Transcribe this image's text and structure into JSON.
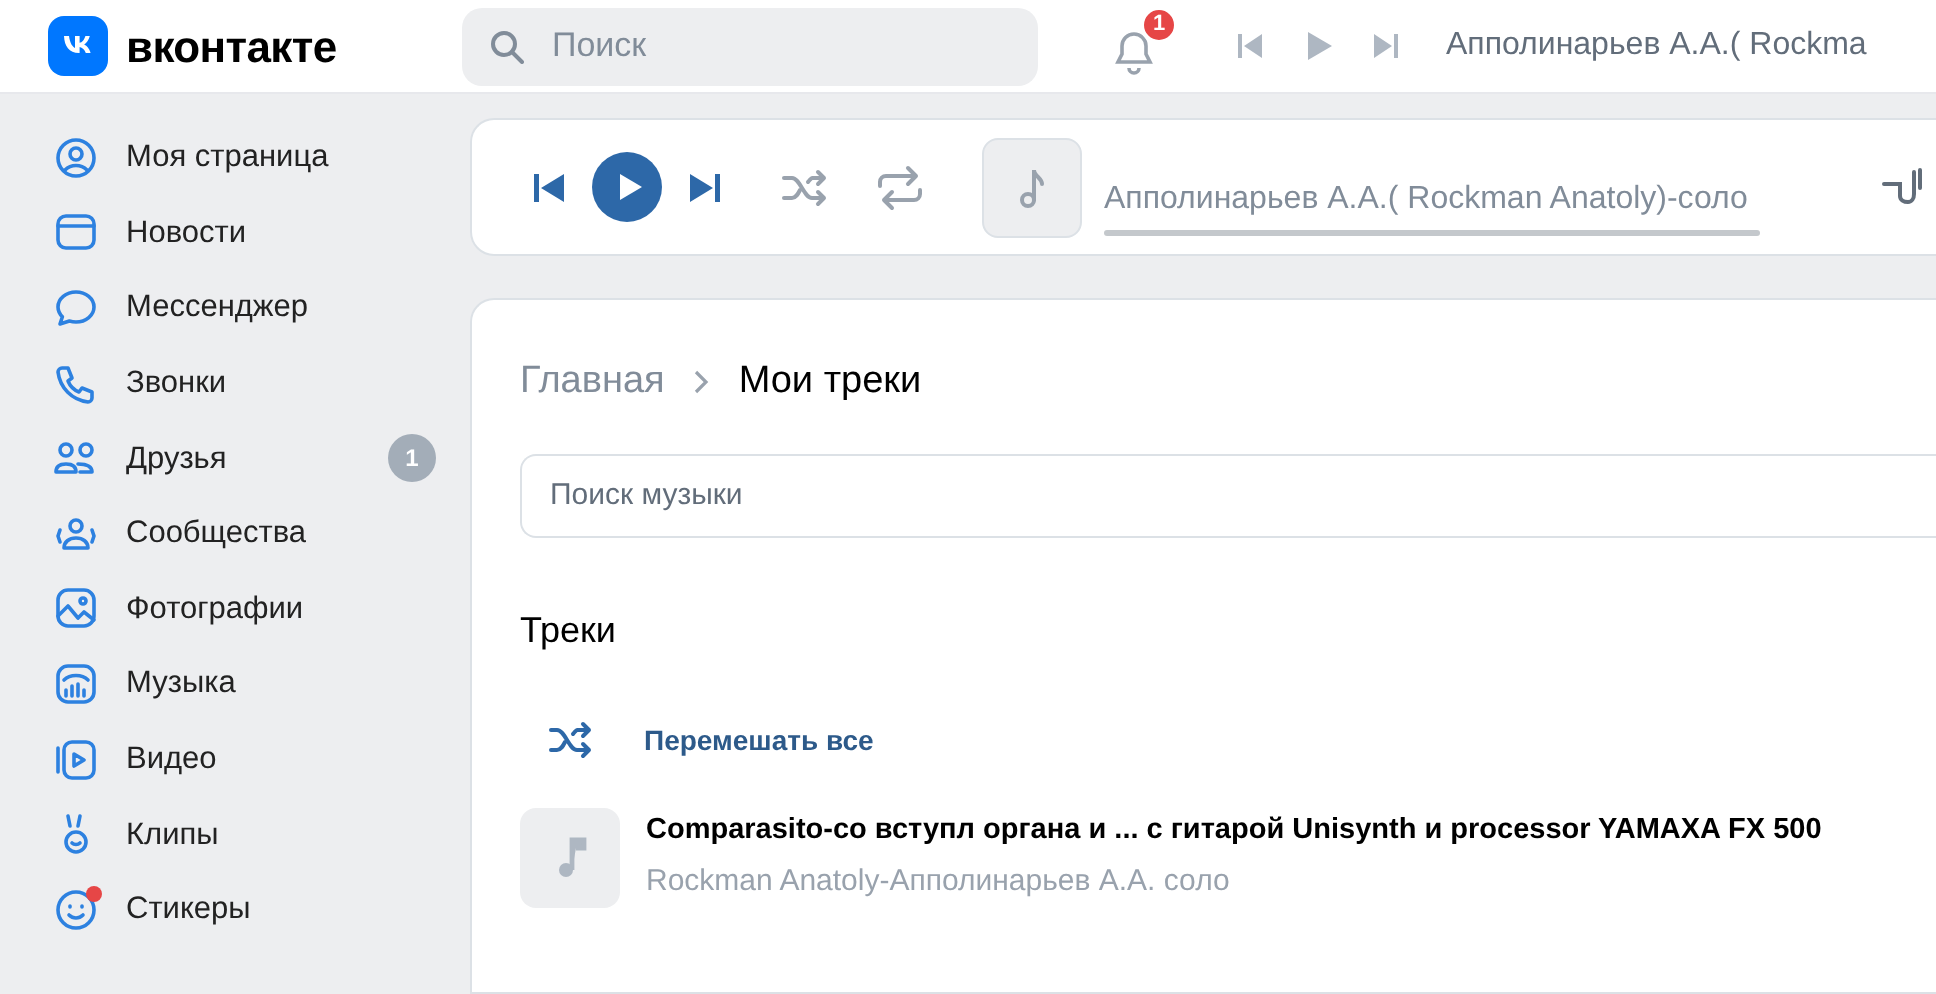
{
  "header": {
    "logo_text": "вконтакте",
    "search": {
      "placeholder": "Поиск"
    },
    "notifications_badge": "1",
    "now_playing": "Апполинарьев А.А.( Rockma"
  },
  "sidebar": {
    "items": [
      {
        "label": "Моя страница",
        "dot": false
      },
      {
        "label": "Новости",
        "dot": false
      },
      {
        "label": "Мессенджер",
        "dot": false
      },
      {
        "label": "Звонки",
        "dot": false
      },
      {
        "label": "Друзья",
        "badge": "1",
        "dot": false
      },
      {
        "label": "Сообщества",
        "dot": false
      },
      {
        "label": "Фотографии",
        "dot": false
      },
      {
        "label": "Музыка",
        "dot": false
      },
      {
        "label": "Видео",
        "dot": false
      },
      {
        "label": "Клипы",
        "dot": false
      },
      {
        "label": "Стикеры",
        "dot": true
      }
    ]
  },
  "player": {
    "track": "Апполинарьев А.А.( Rockman Anatoly)-соло"
  },
  "breadcrumbs": [
    "Главная",
    "Мои треки"
  ],
  "music_search": {
    "placeholder": "Поиск музыки"
  },
  "section_title": "Треки",
  "shuffle_all": "Перемешать все",
  "tracks": [
    {
      "title": "Comparasito-со вступл органа и ... с гитарой Unisynth и processor YAMAXA FX 500",
      "artist": "Rockman Anatoly-Апполинарьев А.А. соло"
    }
  ]
}
